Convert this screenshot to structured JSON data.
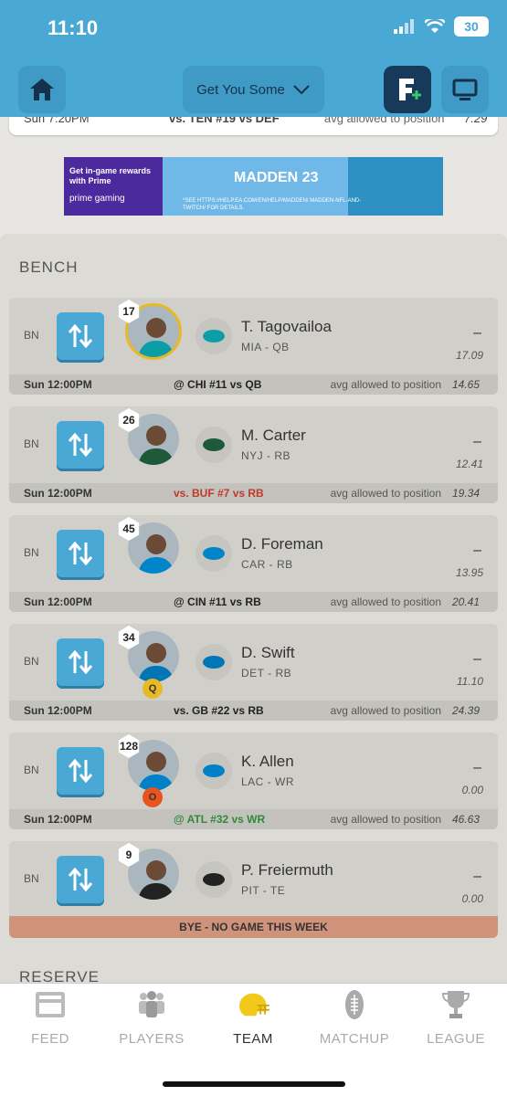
{
  "status": {
    "time": "11:10",
    "battery": "30"
  },
  "header": {
    "team_name": "Get You Some"
  },
  "previous_card": {
    "time": "Sun 7:20PM",
    "opponent": "vs. TEN #19 vs DEF",
    "label": "avg allowed to position",
    "value": "7.29"
  },
  "ad": {
    "line1": "Get in-game rewards with Prime",
    "line2": "prime gaming",
    "title": "MADDEN 23",
    "fine": "*SEE HTTPS://HELP.EA.COM/EN/HELP/MADDEN/ MADDEN-NFL-AND-TWITCH/ FOR DETAILS."
  },
  "bench": {
    "title": "BENCH",
    "players": [
      {
        "slot": "BN",
        "jersey": "17",
        "name": "T. Tagovailoa",
        "pos": "MIA - QB",
        "points": "–",
        "proj": "17.09",
        "time": "Sun 12:00PM",
        "opponent": "@ CHI #11 vs QB",
        "opp_color": "#222222",
        "avg_label": "avg allowed to position",
        "avg": "14.65",
        "status": "",
        "team_color": "#0b9ea8"
      },
      {
        "slot": "BN",
        "jersey": "26",
        "name": "M. Carter",
        "pos": "NYJ - RB",
        "points": "–",
        "proj": "12.41",
        "time": "Sun 12:00PM",
        "opponent": "vs. BUF #7 vs RB",
        "opp_color": "#c0392b",
        "avg_label": "avg allowed to position",
        "avg": "19.34",
        "status": "",
        "team_color": "#1e5a3a"
      },
      {
        "slot": "BN",
        "jersey": "45",
        "name": "D. Foreman",
        "pos": "CAR - RB",
        "points": "–",
        "proj": "13.95",
        "time": "Sun 12:00PM",
        "opponent": "@ CIN #11 vs RB",
        "opp_color": "#222222",
        "avg_label": "avg allowed to position",
        "avg": "20.41",
        "status": "",
        "team_color": "#0085ca"
      },
      {
        "slot": "BN",
        "jersey": "34",
        "name": "D. Swift",
        "pos": "DET - RB",
        "points": "–",
        "proj": "11.10",
        "time": "Sun 12:00PM",
        "opponent": "vs. GB #22 vs RB",
        "opp_color": "#222222",
        "avg_label": "avg allowed to position",
        "avg": "24.39",
        "status": "Q",
        "status_color": "#e8b923",
        "team_color": "#0076b6"
      },
      {
        "slot": "BN",
        "jersey": "128",
        "name": "K. Allen",
        "pos": "LAC - WR",
        "points": "–",
        "proj": "0.00",
        "time": "Sun 12:00PM",
        "opponent": "@ ATL #32 vs WR",
        "opp_color": "#2e8b3a",
        "avg_label": "avg allowed to position",
        "avg": "46.63",
        "status": "O",
        "status_color": "#e8541e",
        "team_color": "#0080c6"
      },
      {
        "slot": "BN",
        "jersey": "9",
        "name": "P. Freiermuth",
        "pos": "PIT - TE",
        "points": "–",
        "proj": "0.00",
        "bye": "BYE - NO GAME THIS WEEK",
        "status": "",
        "team_color": "#222222"
      }
    ]
  },
  "reserve": {
    "title": "RESERVE"
  },
  "tabs": [
    {
      "label": "FEED",
      "icon": "feed-icon",
      "active": false
    },
    {
      "label": "PLAYERS",
      "icon": "players-icon",
      "active": false
    },
    {
      "label": "TEAM",
      "icon": "helmet-icon",
      "active": true
    },
    {
      "label": "MATCHUP",
      "icon": "football-icon",
      "active": false
    },
    {
      "label": "LEAGUE",
      "icon": "trophy-icon",
      "active": false
    }
  ]
}
